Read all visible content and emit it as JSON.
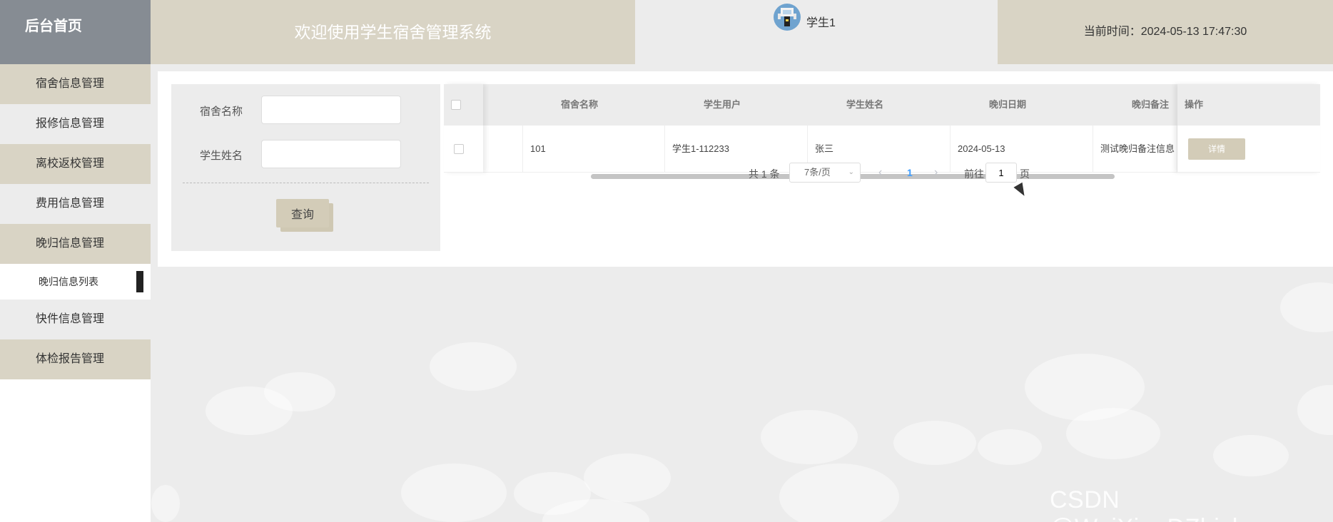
{
  "header": {
    "home_label": "后台首页",
    "welcome": "欢迎使用学生宿舍管理系统",
    "username": "学生1",
    "time_label": "当前时间：",
    "time_value": "2024-05-13 17:47:30"
  },
  "sidebar": {
    "items": [
      {
        "label": "宿舍信息管理"
      },
      {
        "label": "报修信息管理"
      },
      {
        "label": "离校返校管理"
      },
      {
        "label": "费用信息管理"
      },
      {
        "label": "晚归信息管理"
      },
      {
        "label": "晚归信息列表"
      },
      {
        "label": "快件信息管理"
      },
      {
        "label": "体检报告管理"
      }
    ]
  },
  "search": {
    "dorm_label": "宿舍名称",
    "dorm_value": "",
    "student_label": "学生姓名",
    "student_value": "",
    "button": "查询"
  },
  "table": {
    "columns": [
      "宿舍名称",
      "学生用户",
      "学生姓名",
      "晚归日期",
      "晚归备注",
      "操作"
    ],
    "rows": [
      {
        "dorm": "101",
        "user": "学生1-112233",
        "name": "张三",
        "date": "2024-05-13",
        "note": "测试晚归备注信息",
        "action": "详情"
      }
    ]
  },
  "pager": {
    "total": "共 1 条",
    "page_size": "7条/页",
    "current": "1",
    "goto_label": "前往",
    "goto_value": "1",
    "page_word": "页"
  },
  "watermark": "CSDN @WeiXin_DZbishe",
  "colors": {
    "beige": "#d9d4c5",
    "header_home": "#868c93",
    "button": "#d3ccb8",
    "link_active": "#409eff"
  }
}
